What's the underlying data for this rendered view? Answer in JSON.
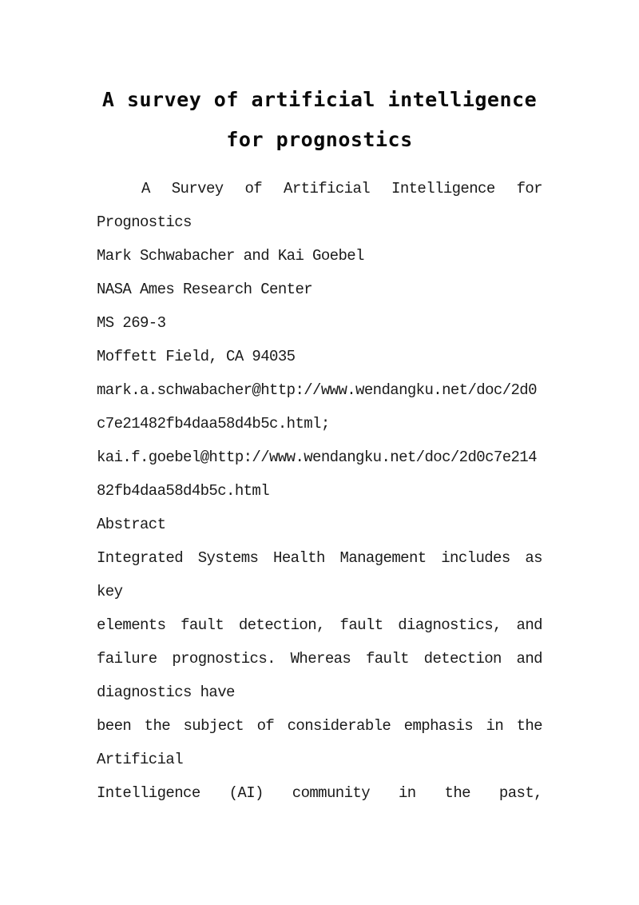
{
  "document": {
    "title_lines": [
      "A survey of artificial intelligence",
      "for prognostics"
    ],
    "lines": [
      {
        "text": "A Survey of Artificial Intelligence for",
        "justify": true,
        "indent": true
      },
      {
        "text": "Prognostics",
        "justify": false
      },
      {
        "text": "Mark Schwabacher and Kai Goebel",
        "justify": false
      },
      {
        "text": "NASA Ames Research Center",
        "justify": false
      },
      {
        "text": "MS 269-3",
        "justify": false
      },
      {
        "text": "Moffett Field, CA 94035",
        "justify": false
      },
      {
        "text": "mark.a.schwabacher@http://www.wendangku.net/doc/2d0",
        "justify": false
      },
      {
        "text": "c7e21482fb4daa58d4b5c.html;",
        "justify": false
      },
      {
        "text": "kai.f.goebel@http://www.wendangku.net/doc/2d0c7e214",
        "justify": false
      },
      {
        "text": "82fb4daa58d4b5c.html",
        "justify": false
      },
      {
        "text": "Abstract",
        "justify": false
      },
      {
        "text": "Integrated Systems Health Management includes as",
        "justify": true
      },
      {
        "text": "key",
        "justify": false
      },
      {
        "text": "elements fault detection, fault diagnostics, and",
        "justify": true
      },
      {
        "text": "failure prognostics. Whereas fault detection and",
        "justify": true
      },
      {
        "text": "diagnostics have",
        "justify": false
      },
      {
        "text": "been the subject of considerable emphasis in the",
        "justify": true
      },
      {
        "text": "Artificial",
        "justify": false
      },
      {
        "text": "Intelligence (AI) community in the past,",
        "justify": true
      }
    ]
  }
}
